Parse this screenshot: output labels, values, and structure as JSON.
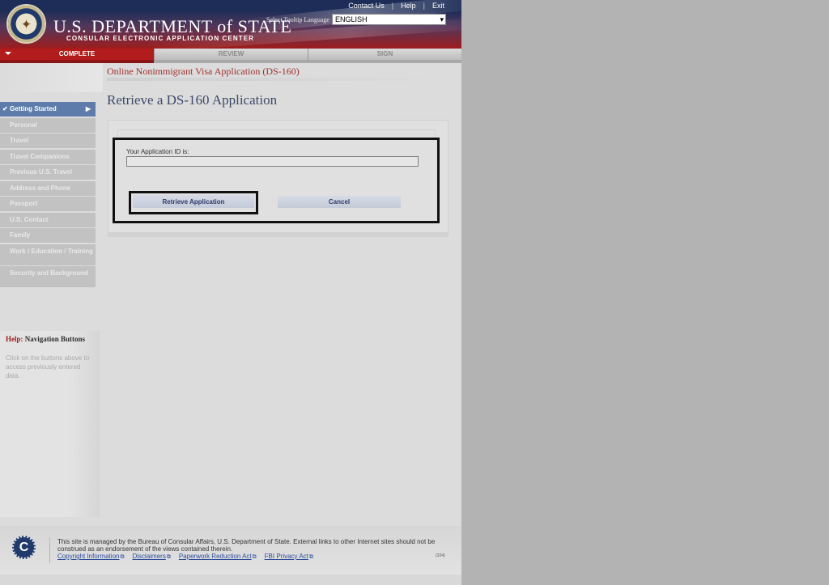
{
  "header": {
    "brand_title": "U.S. DEPARTMENT of STATE",
    "brand_subtitle": "CONSULAR ELECTRONIC APPLICATION CENTER",
    "top_links": [
      "Contact Us",
      "Help",
      "Exit"
    ],
    "tooltip_language_label": "Select Tooltip Language",
    "tooltip_language_value": "ENGLISH"
  },
  "steps": {
    "complete": "COMPLETE",
    "review": "REVIEW",
    "sign": "SIGN"
  },
  "sidebar": {
    "items": [
      {
        "label": "Getting Started",
        "active": true
      },
      {
        "label": "Personal"
      },
      {
        "label": "Travel"
      },
      {
        "label": "Travel Companions"
      },
      {
        "label": "Previous U.S. Travel"
      },
      {
        "label": "Address and Phone"
      },
      {
        "label": "Passport"
      },
      {
        "label": "U.S. Contact"
      },
      {
        "label": "Family"
      },
      {
        "label": "Work / Education / Training"
      },
      {
        "label": "Security and Background"
      }
    ],
    "help_title_red": "Help:",
    "help_title_rest": " Navigation Buttons",
    "help_text": "Click on the buttons above to access previously entered data."
  },
  "main": {
    "app_title": "Online Nonimmigrant Visa Application (DS-160)",
    "heading": "Retrieve a DS-160 Application",
    "id_label": "Your Application ID is:",
    "id_value": "",
    "retrieve_label": "Retrieve Application",
    "cancel_label": "Cancel"
  },
  "footer": {
    "logo_letter": "C",
    "text": "This site is managed by the Bureau of Consular Affairs, U.S. Department of State. External links to other Internet sites should not be construed as an endorsement of the views contained therein.",
    "links": [
      "Copyright Information",
      "Disclaimers",
      "Paperwork Reduction Act",
      "FBI Privacy Act"
    ],
    "code": "(324)"
  },
  "colors": {
    "header_navy": "#1d2d57",
    "header_red": "#9e1d1d",
    "complete_red": "#b31c1c",
    "active_nav_blue": "#5d7cab",
    "heading_blue": "#3b4a67",
    "title_red": "#a03030"
  }
}
